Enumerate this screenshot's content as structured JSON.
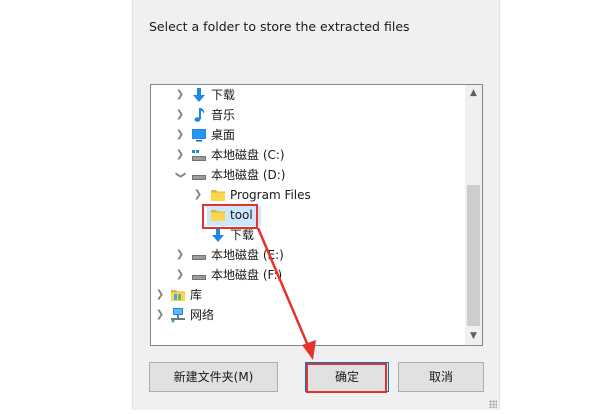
{
  "dialog": {
    "prompt": "Select a folder to store the extracted files"
  },
  "tree": {
    "items": [
      {
        "label": "下载",
        "icon": "download-arrow-icon",
        "expander": "collapsed"
      },
      {
        "label": "音乐",
        "icon": "music-note-icon",
        "expander": "collapsed"
      },
      {
        "label": "桌面",
        "icon": "desktop-icon",
        "expander": "collapsed"
      },
      {
        "label": "本地磁盘 (C:)",
        "icon": "drive-windows-icon",
        "expander": "collapsed"
      },
      {
        "label": "本地磁盘 (D:)",
        "icon": "drive-icon",
        "expander": "expanded"
      },
      {
        "label": "Program Files",
        "icon": "folder-icon",
        "expander": "collapsed"
      },
      {
        "label": "tool",
        "icon": "folder-icon",
        "expander": "none",
        "selected": true
      },
      {
        "label": "下载",
        "icon": "download-arrow-icon",
        "expander": "none"
      },
      {
        "label": "本地磁盘 (E:)",
        "icon": "drive-icon",
        "expander": "collapsed"
      },
      {
        "label": "本地磁盘 (F:)",
        "icon": "drive-icon",
        "expander": "collapsed"
      },
      {
        "label": "库",
        "icon": "library-icon",
        "expander": "collapsed"
      },
      {
        "label": "网络",
        "icon": "network-icon",
        "expander": "collapsed"
      }
    ]
  },
  "buttons": {
    "new_folder": "新建文件夹(M)",
    "ok": "确定",
    "cancel": "取消"
  },
  "colors": {
    "accent": "#0078d7",
    "highlight": "#e5322d",
    "selection": "#cce8ff"
  }
}
